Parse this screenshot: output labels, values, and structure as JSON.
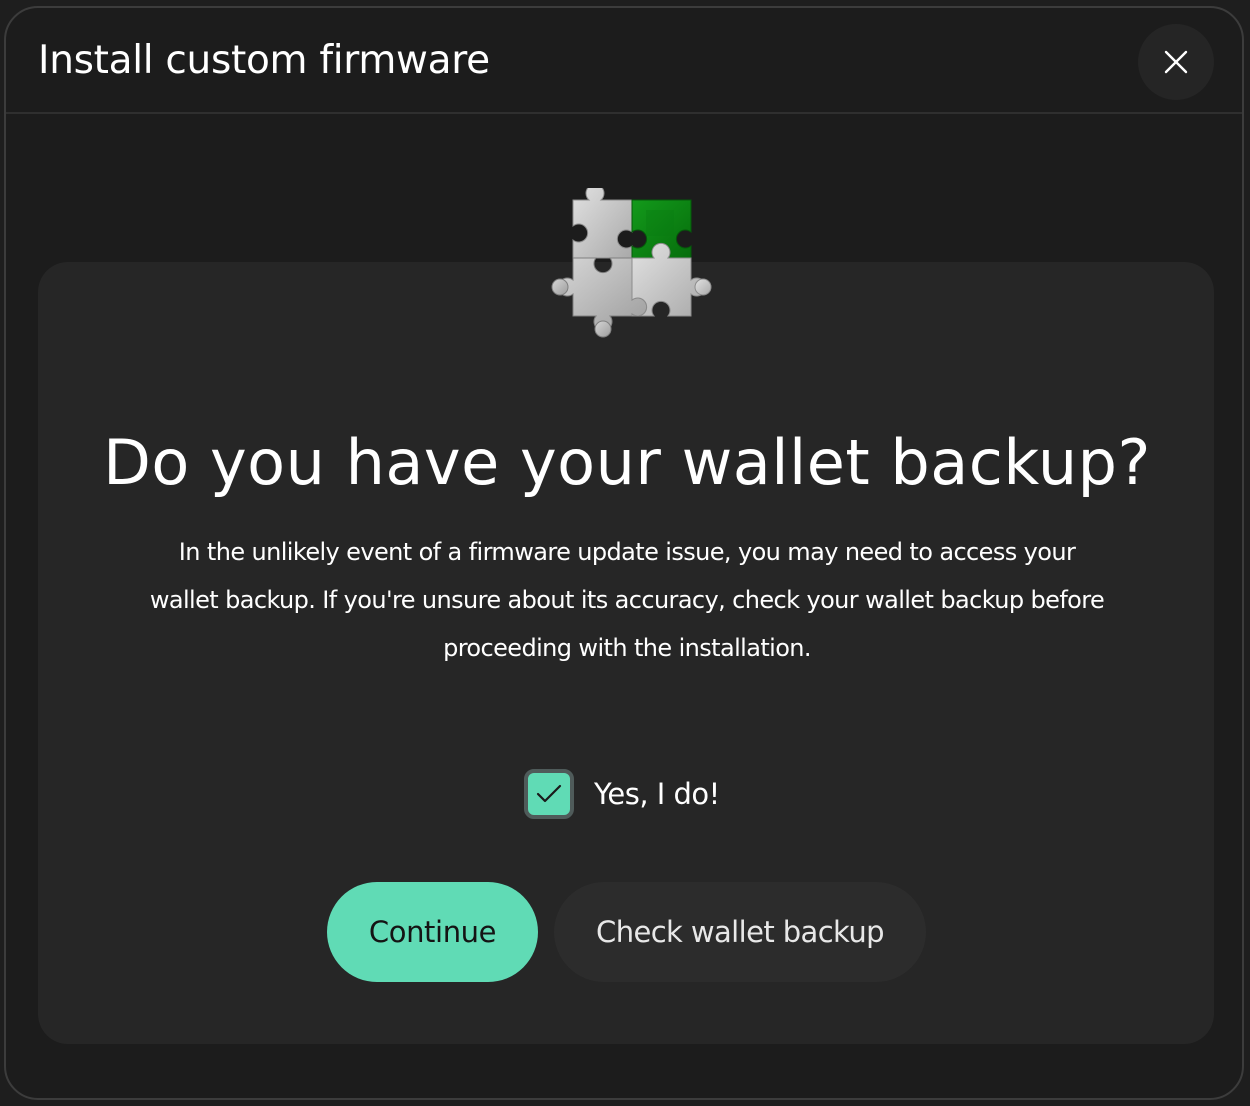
{
  "modal": {
    "title": "Install custom firmware",
    "close_icon": "close-icon"
  },
  "illustration": {
    "icon": "puzzle-pieces-icon",
    "colors": {
      "piece_gray": "#cfcfcf",
      "piece_green": "#0b8a12"
    }
  },
  "content": {
    "question": "Do you have your wallet backup?",
    "description": "In the unlikely event of a firmware update issue, you may need to access your wallet backup. If you're unsure about its accuracy, check your wallet backup before proceeding with the installation."
  },
  "confirmation": {
    "checked": true,
    "label": "Yes, I do!",
    "check_icon": "checkmark-icon"
  },
  "actions": {
    "continue_label": "Continue",
    "check_backup_label": "Check wallet backup"
  },
  "colors": {
    "accent": "#60dbb5",
    "background": "#1c1c1c",
    "card": "#262626"
  }
}
